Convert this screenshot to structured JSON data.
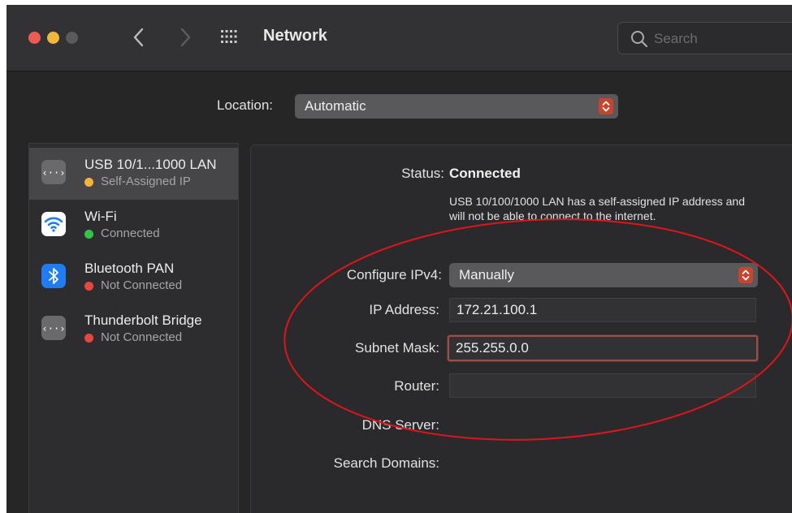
{
  "window": {
    "title": "Network",
    "search": {
      "placeholder": "Search",
      "value": ""
    }
  },
  "location": {
    "label": "Location:",
    "value": "Automatic"
  },
  "services": [
    {
      "name": "USB 10/1...1000 LAN",
      "status": "Self-Assigned IP",
      "status_color": "#f2b53a",
      "icon": "ethernet-icon",
      "selected": true
    },
    {
      "name": "Wi-Fi",
      "status": "Connected",
      "status_color": "#35c24a",
      "icon": "wifi-icon",
      "selected": false
    },
    {
      "name": "Bluetooth PAN",
      "status": "Not Connected",
      "status_color": "#e8473f",
      "icon": "bluetooth-icon",
      "selected": false
    },
    {
      "name": "Thunderbolt Bridge",
      "status": "Not Connected",
      "status_color": "#e8473f",
      "icon": "thunderbolt-bridge-icon",
      "selected": false
    }
  ],
  "detail": {
    "status_label": "Status:",
    "status_value": "Connected",
    "status_description": "USB 10/100/1000 LAN has a self-assigned IP address and will not be able to connect to the internet.",
    "configure_ipv4_label": "Configure IPv4:",
    "configure_ipv4_value": "Manually",
    "ip_address_label": "IP Address:",
    "ip_address_value": "172.21.100.1",
    "subnet_mask_label": "Subnet Mask:",
    "subnet_mask_value": "255.255.0.0",
    "router_label": "Router:",
    "router_value": "",
    "dns_server_label": "DNS Server:",
    "search_domains_label": "Search Domains:"
  },
  "colors": {
    "accent_popup": "#c9442f",
    "annotation": "#e0141b"
  }
}
